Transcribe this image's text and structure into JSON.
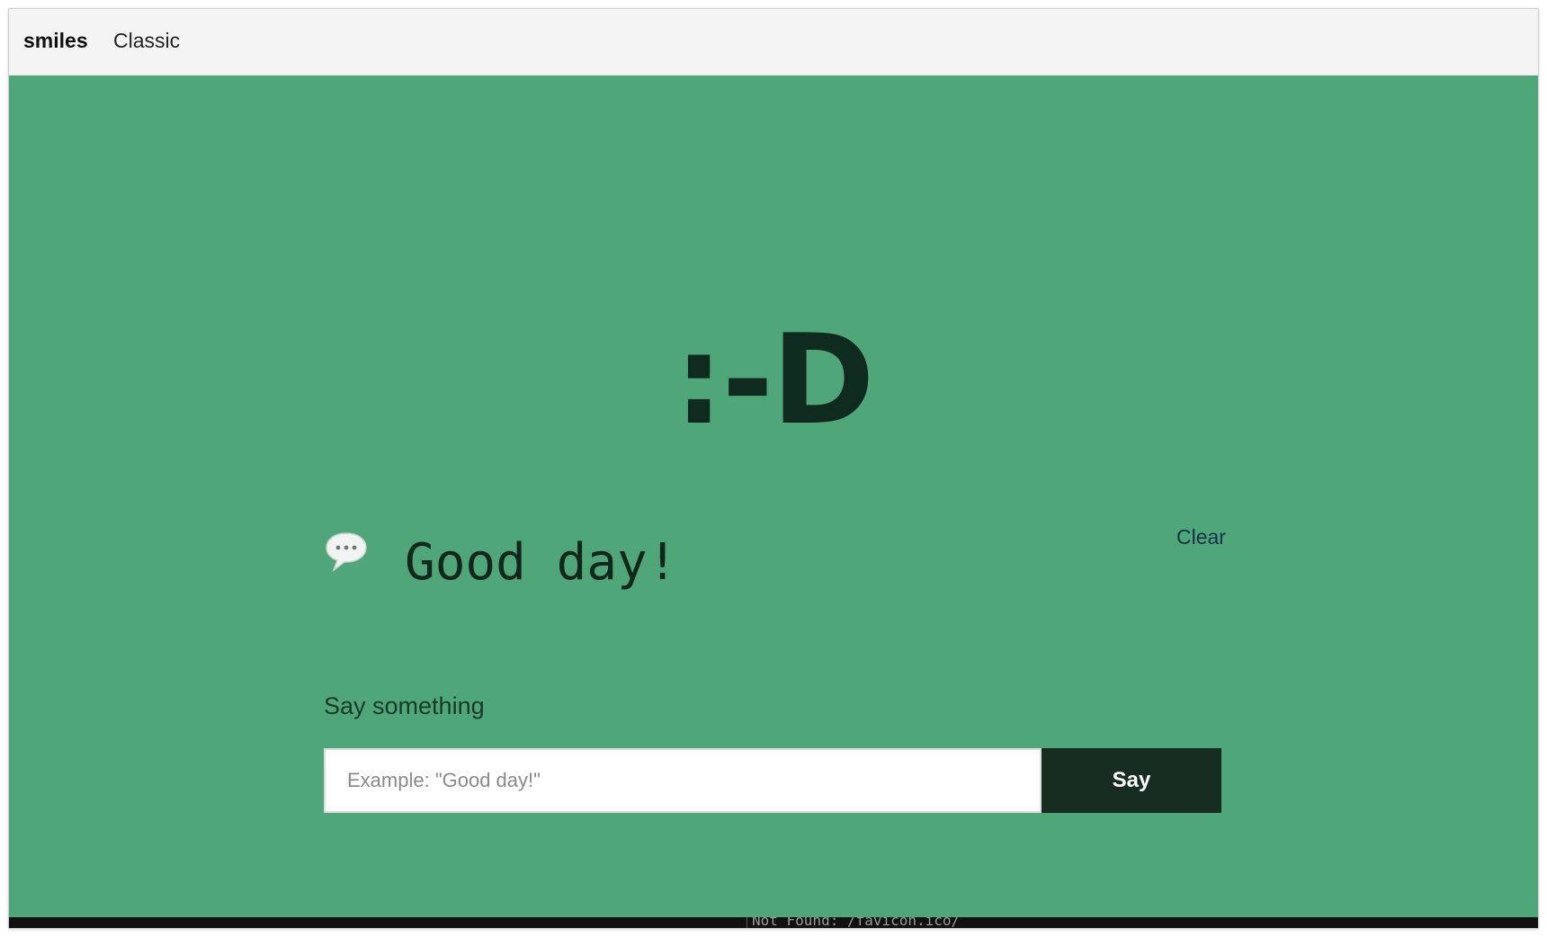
{
  "topbar": {
    "brand": "smiles",
    "nav_link": "Classic"
  },
  "main": {
    "face": ":-D",
    "bubble_icon": "speech-bubble-icon",
    "message": "Good day!",
    "clear_label": "Clear",
    "input_label": "Say something",
    "input_placeholder": "Example: \"Good day!\"",
    "input_value": "",
    "say_button_label": "Say"
  },
  "console": {
    "text": "Not Found: /favicon.ico/"
  },
  "colors": {
    "background": "#4fa679",
    "topbar": "#f4f4f4",
    "face_text": "#0f2b1f",
    "button": "#172d22"
  }
}
